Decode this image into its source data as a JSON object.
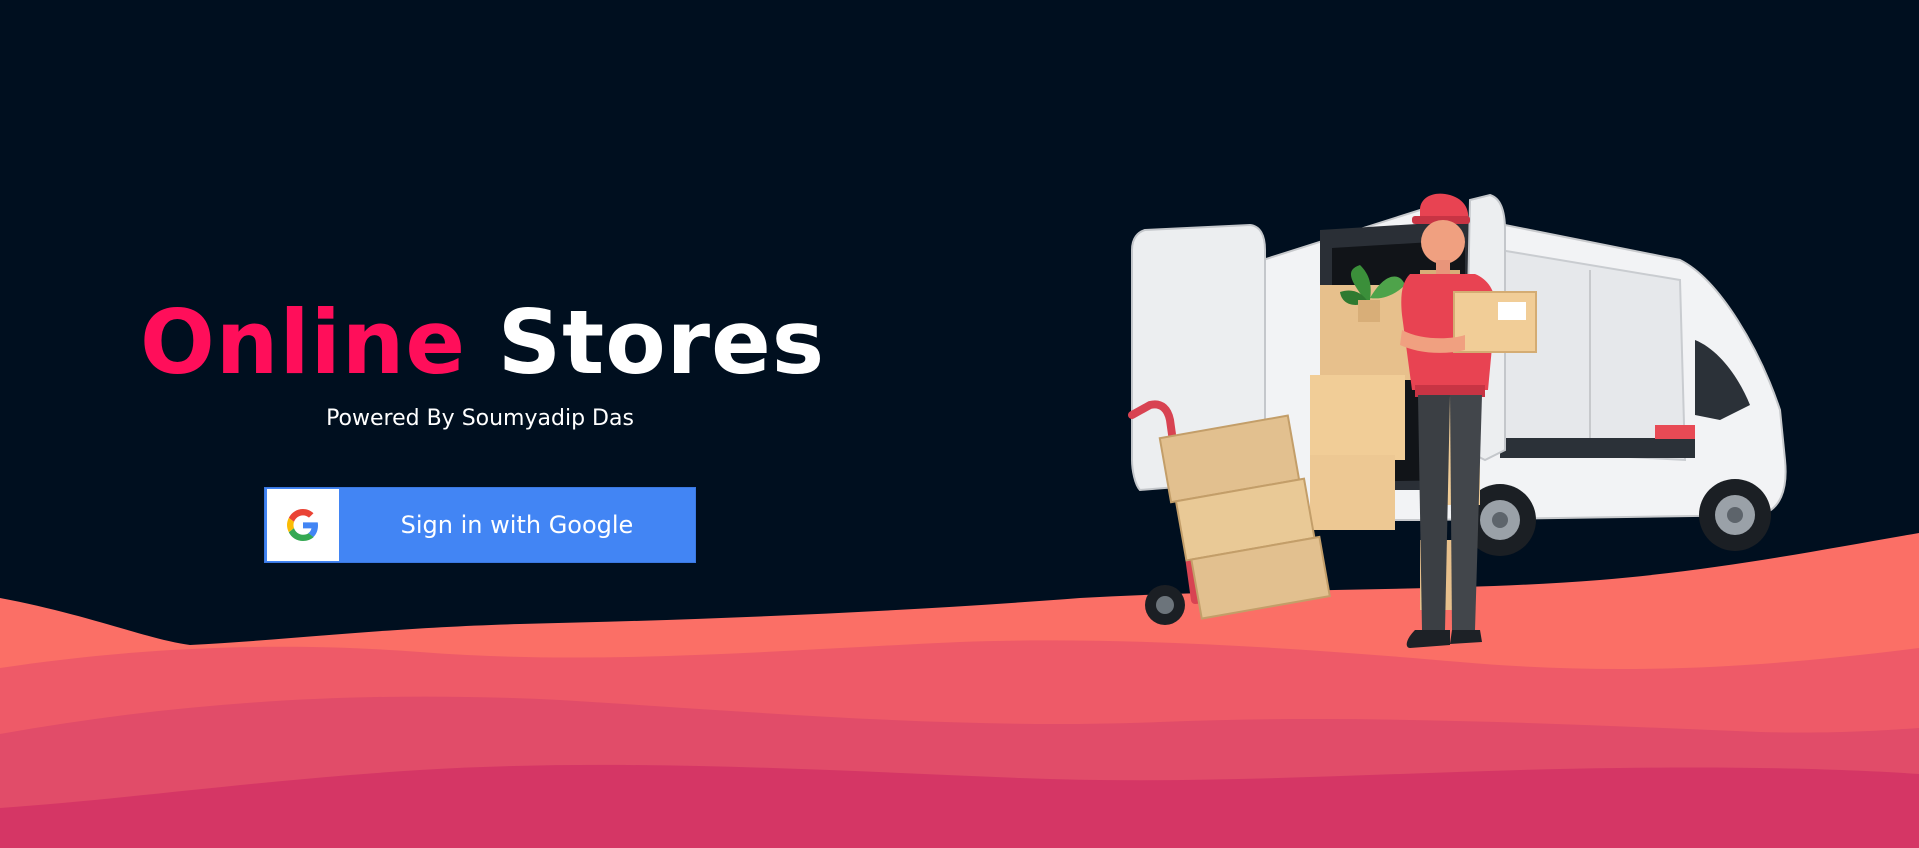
{
  "hero": {
    "title_accent": "Online",
    "title_rest": "Stores",
    "subtitle": "Powered By Soumyadip Das"
  },
  "signin": {
    "label": "Sign in with Google",
    "icon": "google-g-icon"
  },
  "illustration": {
    "subject": "delivery-van-courier-illustration"
  },
  "colors": {
    "background": "#000f1f",
    "accent": "#ff0e5a",
    "google_blue": "#4285f4",
    "wave_1": "#fb6f66",
    "wave_2": "#ee5a68",
    "wave_3": "#e14c69",
    "wave_4": "#d53665"
  }
}
